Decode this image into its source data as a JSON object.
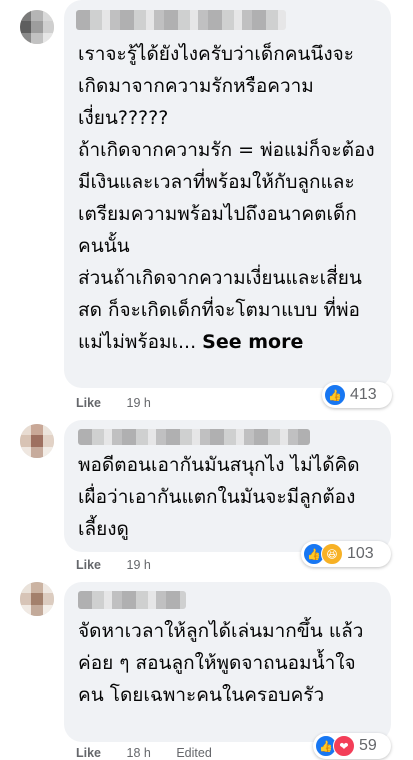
{
  "comments": [
    {
      "text": "เราจะรู้ได้ยังไงครับว่าเด็กคนนึงจะเกิดมาจากความรักหรือความเงี่ยน?????\nถ้าเกิดจากความรัก = พ่อแม่ก็จะต้องมีเงินและเวลาที่พร้อมให้กับลูกและเตรียมความพร้อมไปถึงอนาคตเด็กคนนั้น\nส่วนถ้าเกิดจากความเงี่ยนและเสี่ยนสด ก็จะเกิดเด็กที่จะโตมาแบบ ที่พ่อแม่ไม่พร้อมเ... ",
      "see_more": "See more",
      "like_label": "Like",
      "time": "19 h",
      "reaction_count": "413",
      "reactions": [
        "like-icon"
      ]
    },
    {
      "text": "พอดีตอนเอากันมันสนุกไง ไม่ได้คิดเผื่อว่าเอากันแตกในมันจะมีลูกต้องเลี้ยงดู",
      "like_label": "Like",
      "time": "19 h",
      "reaction_count": "103",
      "reactions": [
        "like-icon",
        "haha-icon"
      ]
    },
    {
      "text": "จัดหาเวลาให้ลูกได้เล่นมากขึ้น แล้วค่อย ๆ สอนลูกให้พูดจาถนอมน้ำใจคน โดยเฉพาะคนในครอบครัว",
      "like_label": "Like",
      "time": "18 h",
      "edited": "Edited",
      "reaction_count": "59",
      "reactions": [
        "like-icon",
        "love-icon"
      ]
    }
  ],
  "colors": {
    "bubble": "#f0f2f5",
    "meta_text": "#65676b",
    "like_blue": "#1877f2",
    "love_red": "#f33e58",
    "haha_yellow": "#f7b125"
  }
}
